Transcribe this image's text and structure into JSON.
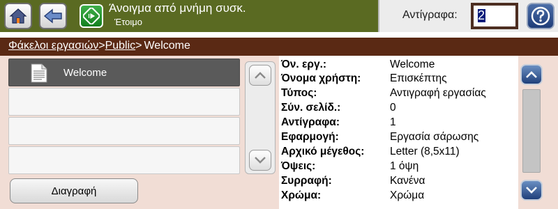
{
  "header": {
    "status_title": "Άνοιγμα από μνήμη συσκ.",
    "status_sub": "Έτοιμο",
    "copies_label": "Αντίγραφα:",
    "copies_value": "2",
    "icons": {
      "home": "home-icon",
      "back": "back-arrow-icon",
      "start": "start-icon",
      "help": "help-icon"
    }
  },
  "breadcrumb": {
    "item1": "Φάκελοι εργασιών",
    "sep1": ">",
    "item2": "Public",
    "sep2": ">",
    "current": "Welcome"
  },
  "job_list": {
    "rows": [
      {
        "name": "Welcome",
        "selected": true
      },
      {
        "name": ""
      },
      {
        "name": ""
      },
      {
        "name": ""
      }
    ]
  },
  "actions": {
    "delete": "Διαγραφή"
  },
  "details": [
    {
      "label": "Όν. εργ.:",
      "value": "Welcome"
    },
    {
      "label": "Όνομα χρήστη:",
      "value": "Επισκέπτης"
    },
    {
      "label": "Τύπος:",
      "value": "Αντιγραφή εργασίας"
    },
    {
      "label": "Σύν. σελίδ.:",
      "value": "0"
    },
    {
      "label": "Αντίγραφα:",
      "value": "1"
    },
    {
      "label": "Εφαρμογή:",
      "value": "Εργασία σάρωσης"
    },
    {
      "label": "Αρχικό μέγεθος:",
      "value": "Letter (8,5x11)"
    },
    {
      "label": "Όψεις:",
      "value": "1 όψη"
    },
    {
      "label": "Συρραφή:",
      "value": "Κανένα"
    },
    {
      "label": "Χρώμα:",
      "value": "Χρώμα"
    }
  ],
  "colors": {
    "header_bg": "#5a6a22",
    "breadcrumb_bg": "#5a2914",
    "panel_bg": "#f1ddd5",
    "selected_row": "#5a5a5a",
    "start_green": "#15801f",
    "help_blue": "#1e3c78"
  }
}
